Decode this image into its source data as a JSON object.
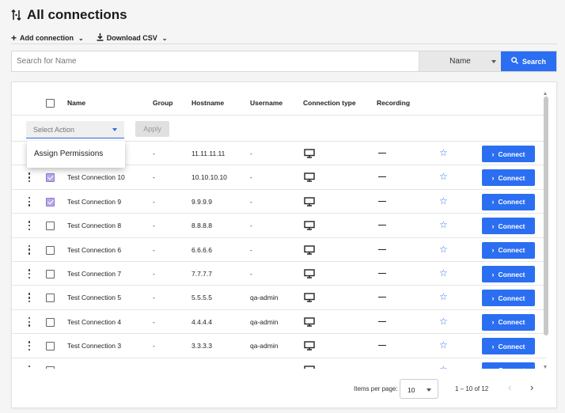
{
  "header": {
    "title": "All connections",
    "add_connection_label": "Add connection",
    "download_csv_label": "Download CSV"
  },
  "search": {
    "placeholder": "Search for Name",
    "value": "",
    "field": "Name",
    "button_label": "Search"
  },
  "table": {
    "columns": [
      "Name",
      "Group",
      "Hostname",
      "Username",
      "Connection type",
      "Recording"
    ],
    "bulk_action_placeholder": "Select Action",
    "apply_label": "Apply",
    "menu_items": [
      "Assign Permissions"
    ],
    "connect_label": "Connect",
    "rows": [
      {
        "name": "",
        "group": "-",
        "hostname": "11.11.11.11",
        "username": "-",
        "checked": false
      },
      {
        "name": "Test Connection 10",
        "group": "-",
        "hostname": "10.10.10.10",
        "username": "-",
        "checked": true
      },
      {
        "name": "Test Connection 9",
        "group": "-",
        "hostname": "9.9.9.9",
        "username": "-",
        "checked": true
      },
      {
        "name": "Test Connection 8",
        "group": "-",
        "hostname": "8.8.8.8",
        "username": "-",
        "checked": false
      },
      {
        "name": "Test Connection 6",
        "group": "-",
        "hostname": "6.6.6.6",
        "username": "-",
        "checked": false
      },
      {
        "name": "Test Connection 7",
        "group": "-",
        "hostname": "7.7.7.7",
        "username": "-",
        "checked": false
      },
      {
        "name": "Test Connection 5",
        "group": "-",
        "hostname": "5.5.5.5",
        "username": "qa-admin",
        "checked": false
      },
      {
        "name": "Test Connection 4",
        "group": "-",
        "hostname": "4.4.4.4",
        "username": "qa-admin",
        "checked": false
      },
      {
        "name": "Test Connection 3",
        "group": "-",
        "hostname": "3.3.3.3",
        "username": "qa-admin",
        "checked": false
      },
      {
        "name": "",
        "group": "",
        "hostname": "",
        "username": "",
        "checked": false
      }
    ]
  },
  "paginator": {
    "items_per_page_label": "Items per page:",
    "page_size": "10",
    "range_label": "1 – 10 of 12"
  },
  "colors": {
    "accent": "#2b6ef2",
    "checkbox_checked": "#b9a8e6"
  }
}
